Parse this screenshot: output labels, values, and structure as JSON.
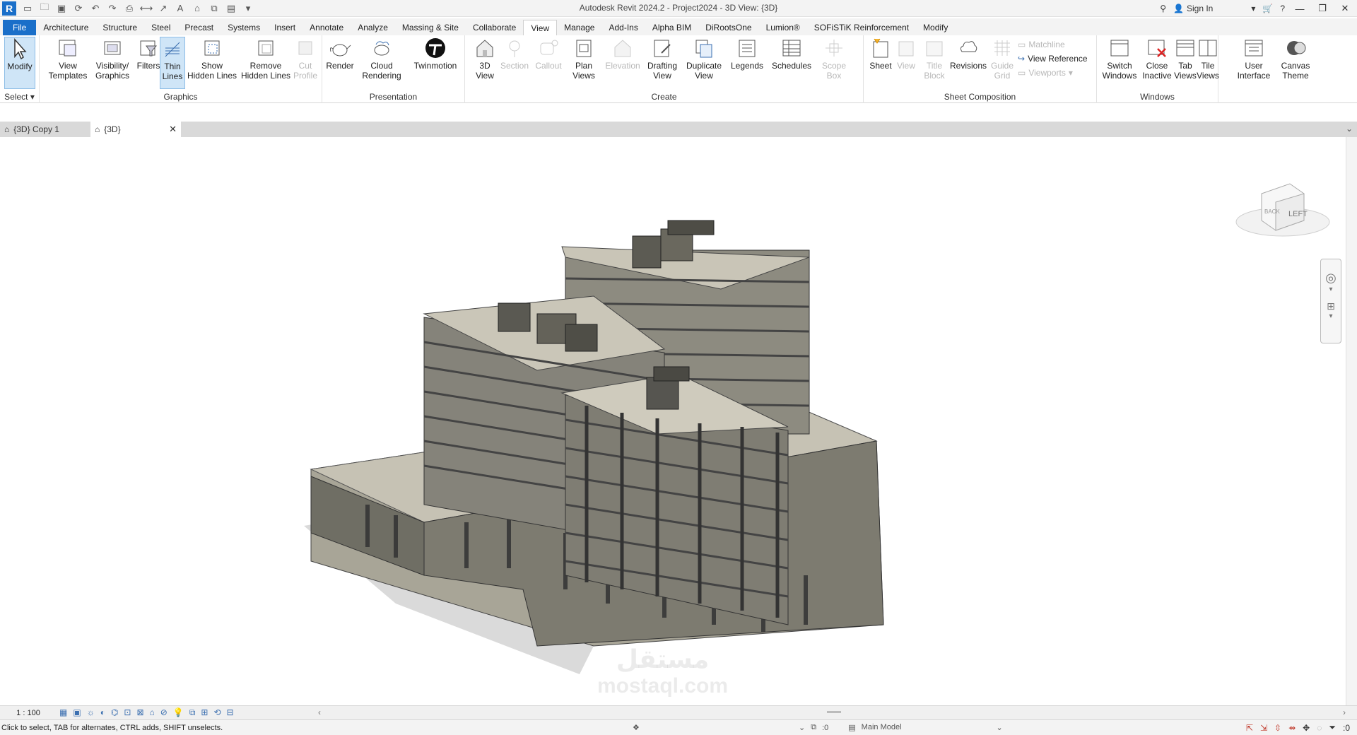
{
  "window": {
    "title": "Autodesk Revit 2024.2 - Project2024 - 3D View: {3D}",
    "app_letter": "R",
    "sign_in": "Sign In"
  },
  "menu": {
    "tabs": [
      "File",
      "Architecture",
      "Structure",
      "Steel",
      "Precast",
      "Systems",
      "Insert",
      "Annotate",
      "Analyze",
      "Massing & Site",
      "Collaborate",
      "View",
      "Manage",
      "Add-Ins",
      "Alpha BIM",
      "DiRootsOne",
      "Lumion®",
      "SOFiSTiK Reinforcement",
      "Modify"
    ],
    "active": "View"
  },
  "ribbon": {
    "select": {
      "modify": "Modify",
      "panel": "Select"
    },
    "graphics": {
      "view_templates": "View\nTemplates",
      "visibility": "Visibility/\nGraphics",
      "filters": "Filters",
      "thin_lines": "Thin\nLines",
      "show_hidden": "Show\nHidden Lines",
      "remove_hidden": "Remove\nHidden Lines",
      "cut_profile": "Cut\nProfile",
      "panel": "Graphics"
    },
    "presentation": {
      "render": "Render",
      "cloud_rendering": "Cloud\nRendering",
      "twinmotion": "Twinmotion",
      "panel": "Presentation"
    },
    "create": {
      "view3d": "3D\nView",
      "section": "Section",
      "callout": "Callout",
      "plan_views": "Plan\nViews",
      "elevation": "Elevation",
      "drafting_view": "Drafting\nView",
      "duplicate_view": "Duplicate\nView",
      "legends": "Legends",
      "schedules": "Schedules",
      "scope_box": "Scope\nBox",
      "panel": "Create"
    },
    "sheet": {
      "sheet": "Sheet",
      "view": "View",
      "title_block": "Title\nBlock",
      "revisions": "Revisions",
      "guide_grid": "Guide\nGrid",
      "matchline": "Matchline",
      "view_reference": "View  Reference",
      "viewports": "Viewports",
      "panel": "Sheet Composition"
    },
    "windows": {
      "switch": "Switch\nWindows",
      "close_inactive": "Close\nInactive",
      "tab_views": "Tab\nViews",
      "tile_views": "Tile\nViews",
      "panel": "Windows"
    },
    "ui": {
      "user_interface": "User\nInterface",
      "canvas_theme": "Canvas\nTheme"
    }
  },
  "view_tabs": [
    {
      "label": "{3D} Copy 1",
      "active": false
    },
    {
      "label": "{3D}",
      "active": true
    }
  ],
  "viewcube": {
    "face_left": "LEFT",
    "face_back": "BACK"
  },
  "watermark": {
    "line1": "مستقل",
    "line2": "mostaql.com"
  },
  "view_bar": {
    "scale": "1 : 100"
  },
  "status": {
    "hint": "Click to select, TAB for alternates, CTRL adds, SHIFT unselects.",
    "worksets": ":0",
    "model": "Main Model",
    "filter_count": ":0"
  },
  "colors": {
    "accent": "#1a6fc9",
    "concrete": "#b9b5a8",
    "concrete_dark": "#7c7a70",
    "shadow": "#d6d6d6"
  }
}
